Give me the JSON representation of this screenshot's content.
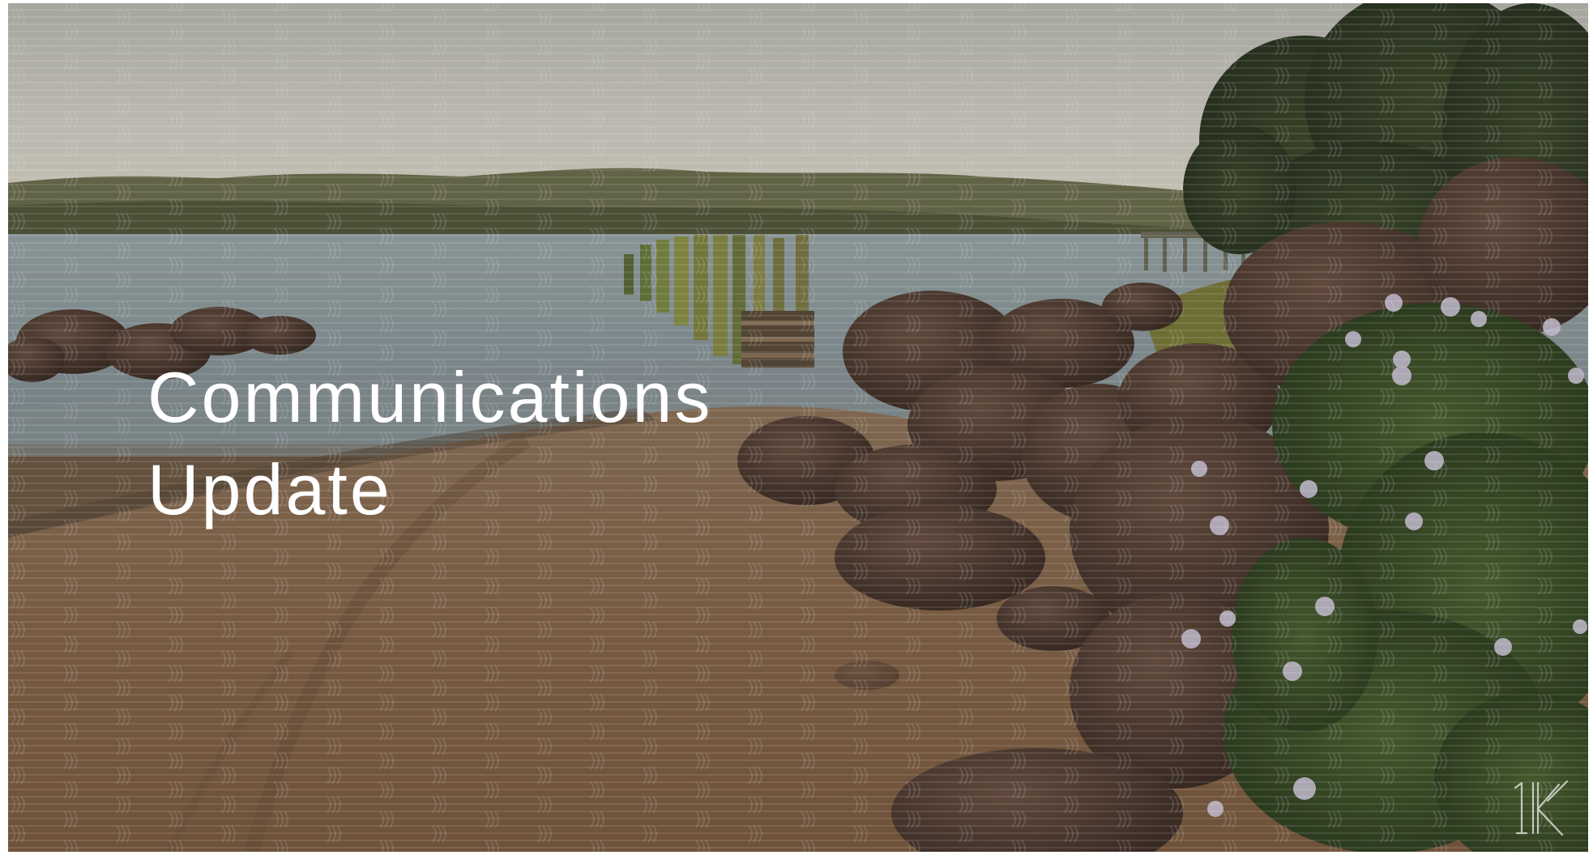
{
  "slide": {
    "title_line1": "Communications",
    "title_line2": "Update"
  },
  "background": {
    "description_icon": "coastal-beach-photo",
    "sky_color": "#c9c7bd",
    "water_color": "#8d9ba0",
    "sand_color": "#8a6a4e",
    "rock_color": "#4a3a30",
    "foliage_color": "#3a4a24",
    "flower_color": "#e6dcef"
  },
  "logo": {
    "icon": "brand-logo-icon",
    "color": "#dcdcd6"
  }
}
